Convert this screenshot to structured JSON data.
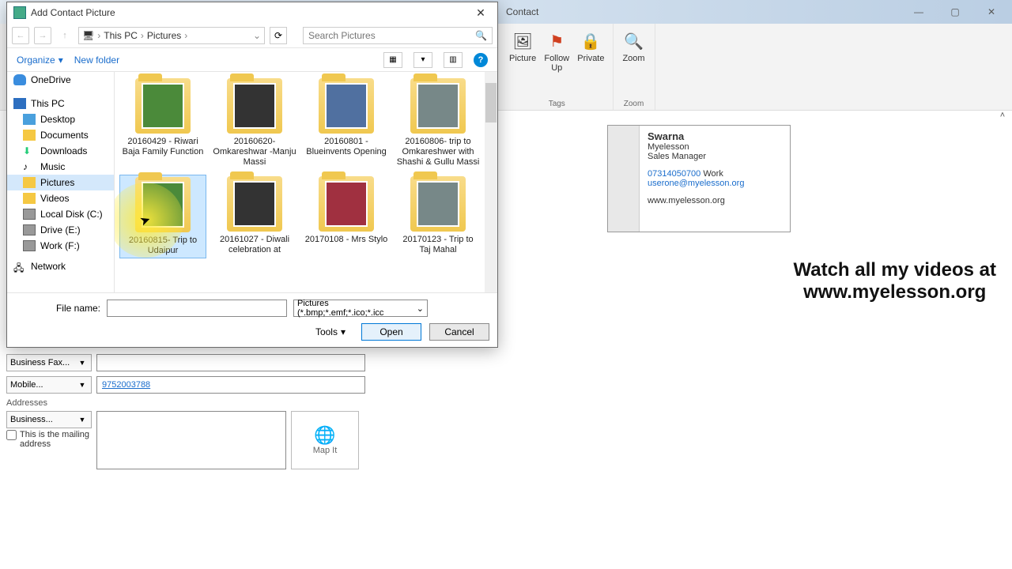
{
  "bg": {
    "title": "Contact",
    "ribbon": {
      "picture": "Picture",
      "followup": "Follow\nUp",
      "private": "Private",
      "zoom": "Zoom",
      "tags_group": "Tags",
      "zoom_group": "Zoom"
    },
    "contact_card": {
      "name": "Swarna",
      "company": "Myelesson",
      "title": "Sales Manager",
      "phone": "07314050700",
      "phone_label": "Work",
      "email": "userone@myelesson.org",
      "website": "www.myelesson.org"
    },
    "watermark_line1": "Watch all my videos at",
    "watermark_line2": "www.myelesson.org",
    "form": {
      "business_fax": "Business Fax...",
      "mobile": "Mobile...",
      "mobile_value": "9752003788",
      "addresses_label": "Addresses",
      "business": "Business...",
      "mailing_check": "This is the mailing address",
      "mapit": "Map It"
    }
  },
  "dialog": {
    "title": "Add Contact Picture",
    "breadcrumb": {
      "pc": "This PC",
      "folder": "Pictures"
    },
    "search_placeholder": "Search Pictures",
    "organize": "Organize",
    "newfolder": "New folder",
    "tree": {
      "onedrive": "OneDrive",
      "thispc": "This PC",
      "desktop": "Desktop",
      "documents": "Documents",
      "downloads": "Downloads",
      "music": "Music",
      "pictures": "Pictures",
      "videos": "Videos",
      "localc": "Local Disk (C:)",
      "drivee": "Drive  (E:)",
      "workf": "Work (F:)",
      "network": "Network"
    },
    "files": [
      "20160429 - Riwari Baja Family Function",
      "20160620- Omkareshwar -Manju Massi",
      "20160801 - Blueinvents Opening",
      "20160806- trip to Omkareshwer with Shashi & Gullu Massi",
      "20160815- Trip to Udaipur",
      "20161027 - Diwali celebration at",
      "20170108 - Mrs Stylo",
      "20170123 - Trip to Taj Mahal"
    ],
    "filename_label": "File name:",
    "filter": "Pictures (*.bmp;*.emf;*.ico;*.icc",
    "tools": "Tools",
    "open": "Open",
    "cancel": "Cancel"
  }
}
